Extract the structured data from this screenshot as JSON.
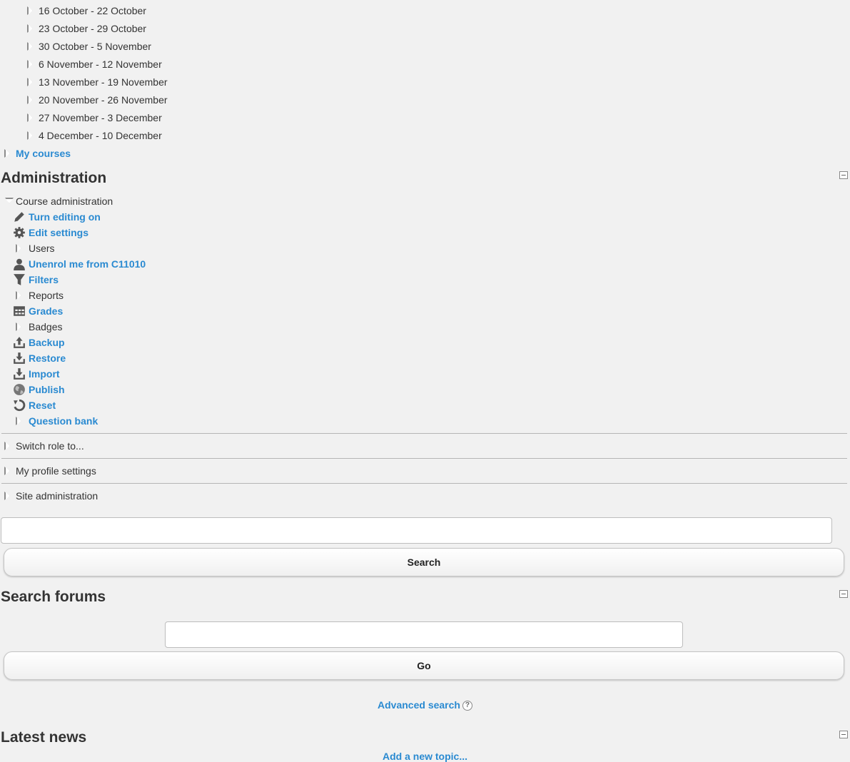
{
  "weeks": [
    "16 October - 22 October",
    "23 October - 29 October",
    "30 October - 5 November",
    "6 November - 12 November",
    "13 November - 19 November",
    "20 November - 26 November",
    "27 November - 3 December",
    "4 December - 10 December"
  ],
  "my_courses": "My courses",
  "administration": {
    "title": "Administration",
    "course_admin": "Course administration",
    "items": {
      "turn_editing_on": "Turn editing on",
      "edit_settings": "Edit settings",
      "users": "Users",
      "unenrol": "Unenrol me from C11010",
      "filters": "Filters",
      "reports": "Reports",
      "grades": "Grades",
      "badges": "Badges",
      "backup": "Backup",
      "restore": "Restore",
      "import": "Import",
      "publish": "Publish",
      "reset": "Reset",
      "question_bank": "Question bank"
    },
    "switch_role": "Switch role to...",
    "profile_settings": "My profile settings",
    "site_admin": "Site administration"
  },
  "search": {
    "button": "Search",
    "value": ""
  },
  "search_forums": {
    "title": "Search forums",
    "button": "Go",
    "advanced": "Advanced search",
    "value": ""
  },
  "latest_news": {
    "title": "Latest news",
    "add_topic": "Add a new topic..."
  },
  "colors": {
    "link": "#2a8ad1",
    "text": "#333333",
    "icon": "#555555"
  }
}
